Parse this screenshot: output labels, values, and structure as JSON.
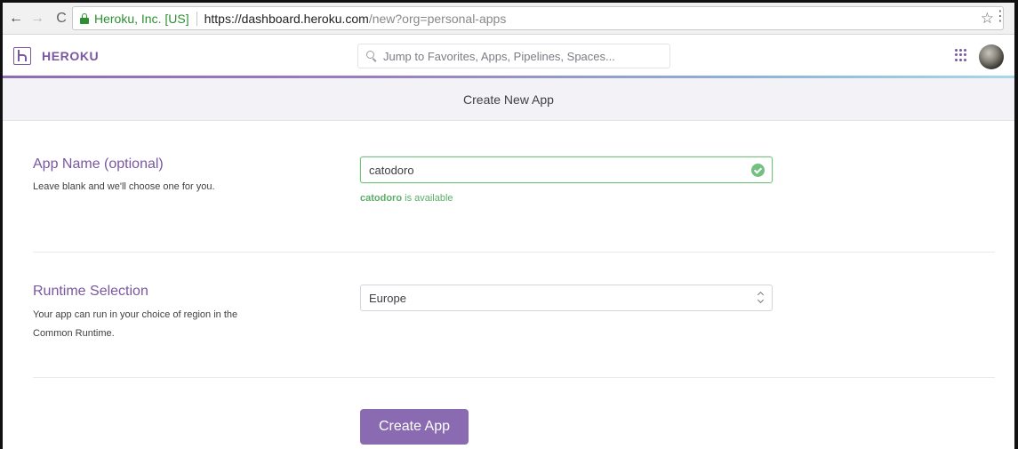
{
  "browser": {
    "back_icon": "←",
    "forward_icon": "→",
    "reload_icon": "C",
    "site_identity": "Heroku, Inc. [US]",
    "url_host": "https://dashboard.heroku.com",
    "url_path": "/new?org=personal-apps",
    "star_icon": "☆",
    "menu_icon": "⋮"
  },
  "header": {
    "logo_text": "HEROKU",
    "search_placeholder": "Jump to Favorites, Apps, Pipelines, Spaces...",
    "accent_color": "#79589f"
  },
  "subheader": {
    "title": "Create New App"
  },
  "form": {
    "app_name": {
      "label": "App Name (optional)",
      "help": "Leave blank and we'll choose one for you.",
      "value": "catodoro",
      "availability_name": "catodoro",
      "availability_suffix": " is available"
    },
    "runtime": {
      "label": "Runtime Selection",
      "help": "Your app can run in your choice of region in the Common Runtime.",
      "selected": "Europe"
    },
    "submit_label": "Create App"
  },
  "colors": {
    "success": "#74c080",
    "button": "#8a6ab0"
  }
}
